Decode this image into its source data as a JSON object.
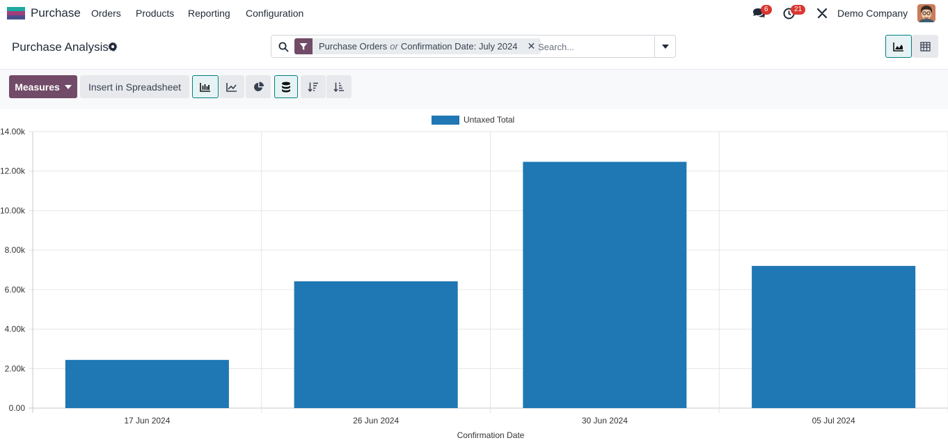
{
  "navbar": {
    "app_name": "Purchase",
    "menu": [
      "Orders",
      "Products",
      "Reporting",
      "Configuration"
    ],
    "messages_count": "6",
    "activities_count": "21",
    "company": "Demo Company",
    "logo_colors": [
      "#1ea8a0",
      "#a03e7c",
      "#4a4e8f"
    ]
  },
  "control": {
    "title": "Purchase Analysis",
    "facet": {
      "part1": "Purchase Orders",
      "separator": "or",
      "part2": "Confirmation Date: July 2024"
    },
    "search_placeholder": "Search..."
  },
  "toolbar": {
    "measures_label": "Measures",
    "spreadsheet_label": "Insert in Spreadsheet"
  },
  "chart_data": {
    "type": "bar",
    "categories": [
      "17 Jun 2024",
      "26 Jun 2024",
      "30 Jun 2024",
      "05 Jul 2024"
    ],
    "series": [
      {
        "name": "Untaxed Total",
        "values": [
          2440,
          6420,
          12470,
          7200
        ],
        "color": "#1f77b4"
      }
    ],
    "xlabel": "Confirmation Date",
    "ylabel": "",
    "ylim": [
      0,
      14000
    ],
    "yticks": [
      "0.00",
      "2.00k",
      "4.00k",
      "6.00k",
      "8.00k",
      "10.00k",
      "12.00k",
      "14.00k"
    ],
    "legend": "top-center",
    "grid": true
  }
}
